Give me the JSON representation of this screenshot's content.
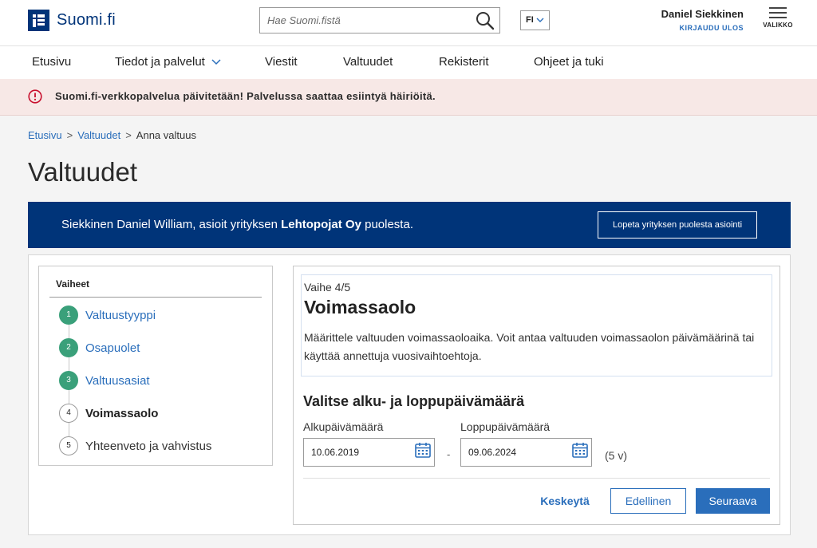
{
  "header": {
    "logo_text": "Suomi.fi",
    "search_placeholder": "Hae Suomi.fistä",
    "language": "FI",
    "user_name": "Daniel Siekkinen",
    "logout_label": "KIRJAUDU ULOS",
    "menu_label": "VALIKKO"
  },
  "nav": {
    "items": [
      "Etusivu",
      "Tiedot ja palvelut",
      "Viestit",
      "Valtuudet",
      "Rekisterit",
      "Ohjeet ja tuki"
    ]
  },
  "alert": {
    "text": "Suomi.fi-verkkopalvelua päivitetään! Palvelussa saattaa esiintyä häiriöitä."
  },
  "breadcrumb": {
    "items": [
      "Etusivu",
      "Valtuudet",
      "Anna valtuus"
    ],
    "separator": ">"
  },
  "page_title": "Valtuudet",
  "banner": {
    "text_before": "Siekkinen Daniel William, asioit yrityksen ",
    "company": "Lehtopojat Oy",
    "text_after": " puolesta.",
    "button_label": "Lopeta yrityksen puolesta asiointi"
  },
  "steps": {
    "title": "Vaiheet",
    "items": [
      {
        "number": "1",
        "label": "Valtuustyyppi"
      },
      {
        "number": "2",
        "label": "Osapuolet"
      },
      {
        "number": "3",
        "label": "Valtuusasiat"
      },
      {
        "number": "4",
        "label": "Voimassaolo"
      },
      {
        "number": "5",
        "label": "Yhteenveto ja vahvistus"
      }
    ]
  },
  "content": {
    "step_indicator": "Vaihe 4/5",
    "title": "Voimassaolo",
    "description": "Määrittele valtuuden voimassaoloaika. Voit antaa valtuuden voimassaolon päivämäärinä tai käyttää annettuja vuosivaihtoehtoja.",
    "date_heading": "Valitse alku- ja loppupäivämäärä",
    "start_label": "Alkupäivämäärä",
    "start_value": "10.06.2019",
    "end_label": "Loppupäivämäärä",
    "end_value": "09.06.2024",
    "range_separator": "-",
    "duration": "(5 v)",
    "cancel_label": "Keskeytä",
    "previous_label": "Edellinen",
    "next_label": "Seuraava"
  },
  "colors": {
    "brand": "#003479",
    "link": "#2a6ebb",
    "step_done": "#3aa07a",
    "alert_bg": "#f7e8e6",
    "alert_icon": "#c8102e"
  },
  "icons": [
    "logo-mark-icon",
    "search-icon",
    "chevron-down-icon",
    "hamburger-icon",
    "alert-circle-icon",
    "calendar-icon"
  ]
}
